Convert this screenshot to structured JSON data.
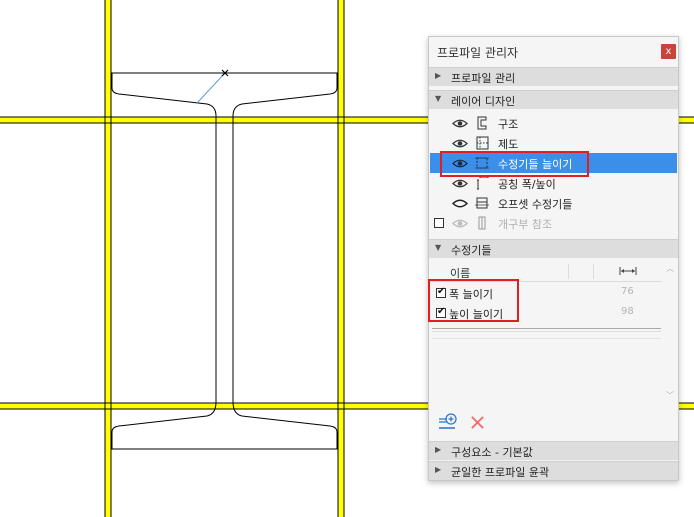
{
  "panel": {
    "title": "프로파일 관리자",
    "close_label": "x"
  },
  "sections": {
    "profile_manage": "프로파일 관리",
    "layer_design": "레이어 디자인",
    "modifiers": "수정기들",
    "component_defaults": "구성요소 - 기본값",
    "uniform_outline": "균일한 프로파일 윤곽"
  },
  "layers": [
    {
      "name": "구조",
      "icon": "structure-icon"
    },
    {
      "name": "제도",
      "icon": "drafting-icon"
    },
    {
      "name": "수정기들 늘이기",
      "icon": "stretch-icon",
      "selected": true
    },
    {
      "name": "공칭 폭/높이",
      "icon": "nominal-size-icon"
    },
    {
      "name": "오프셋 수정기들",
      "icon": "offset-icon"
    },
    {
      "name": "개구부 참조",
      "icon": "opening-icon",
      "disabled": true
    }
  ],
  "modifiers_table": {
    "header_name": "이름",
    "rows": [
      {
        "name": "폭 늘이기",
        "value": "76",
        "checked": true
      },
      {
        "name": "높이 늘이기",
        "value": "98",
        "checked": true
      }
    ]
  },
  "colors": {
    "guide_yellow": "#ffff00",
    "selection_blue": "#3b8fe8",
    "highlight_red": "#e02020",
    "delete_red": "#ef6b6b"
  }
}
